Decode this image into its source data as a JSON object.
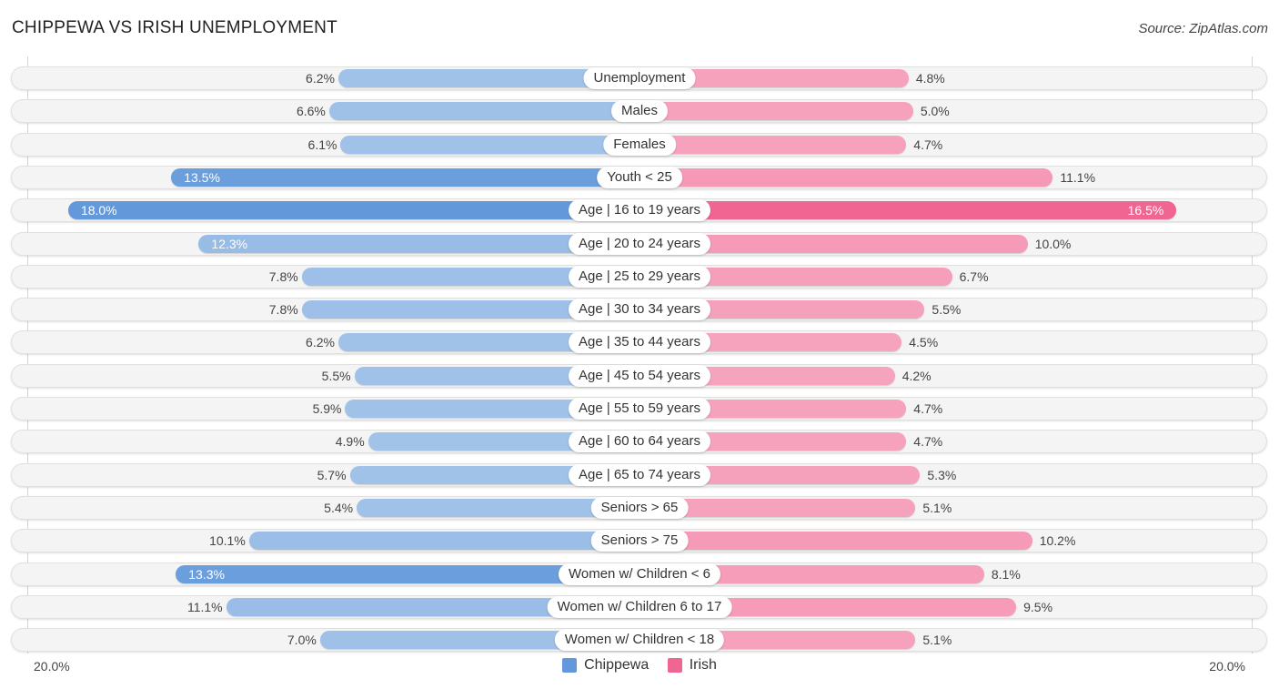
{
  "header": {
    "title": "CHIPPEWA VS IRISH UNEMPLOYMENT",
    "source": "Source: ZipAtlas.com"
  },
  "colors": {
    "chippewa_strong": "#6399da",
    "chippewa_light": "#a8c7ea",
    "irish_strong": "#f06592",
    "irish_light": "#f7a9c1",
    "row_bg": "#f4f4f4"
  },
  "axis": {
    "left_label": "20.0%",
    "right_label": "20.0%"
  },
  "legend": [
    {
      "name": "Chippewa",
      "color": "#6399da"
    },
    {
      "name": "Irish",
      "color": "#f06592"
    }
  ],
  "chart_data": {
    "type": "bar",
    "orientation": "horizontal-diverging",
    "title": "CHIPPEWA VS IRISH UNEMPLOYMENT",
    "xlabel": "",
    "ylabel": "",
    "xlim": [
      0,
      20
    ],
    "unit": "%",
    "legend_position": "bottom-center",
    "categories": [
      "Unemployment",
      "Males",
      "Females",
      "Youth < 25",
      "Age | 16 to 19 years",
      "Age | 20 to 24 years",
      "Age | 25 to 29 years",
      "Age | 30 to 34 years",
      "Age | 35 to 44 years",
      "Age | 45 to 54 years",
      "Age | 55 to 59 years",
      "Age | 60 to 64 years",
      "Age | 65 to 74 years",
      "Seniors > 65",
      "Seniors > 75",
      "Women w/ Children < 6",
      "Women w/ Children 6 to 17",
      "Women w/ Children < 18"
    ],
    "series": [
      {
        "name": "Chippewa",
        "side": "left",
        "values": [
          6.2,
          6.6,
          6.1,
          13.5,
          18.0,
          12.3,
          7.8,
          7.8,
          6.2,
          5.5,
          5.9,
          4.9,
          5.7,
          5.4,
          10.1,
          13.3,
          11.1,
          7.0
        ],
        "labels": [
          "6.2%",
          "6.6%",
          "6.1%",
          "13.5%",
          "18.0%",
          "12.3%",
          "7.8%",
          "7.8%",
          "6.2%",
          "5.5%",
          "5.9%",
          "4.9%",
          "5.7%",
          "5.4%",
          "10.1%",
          "13.3%",
          "11.1%",
          "7.0%"
        ]
      },
      {
        "name": "Irish",
        "side": "right",
        "values": [
          4.8,
          5.0,
          4.7,
          11.1,
          16.5,
          10.0,
          6.7,
          5.5,
          4.5,
          4.2,
          4.7,
          4.7,
          5.3,
          5.1,
          10.2,
          8.1,
          9.5,
          5.1
        ],
        "labels": [
          "4.8%",
          "5.0%",
          "4.7%",
          "11.1%",
          "16.5%",
          "10.0%",
          "6.7%",
          "5.5%",
          "4.5%",
          "4.2%",
          "4.7%",
          "4.7%",
          "5.3%",
          "5.1%",
          "10.2%",
          "8.1%",
          "9.5%",
          "5.1%"
        ]
      }
    ]
  }
}
